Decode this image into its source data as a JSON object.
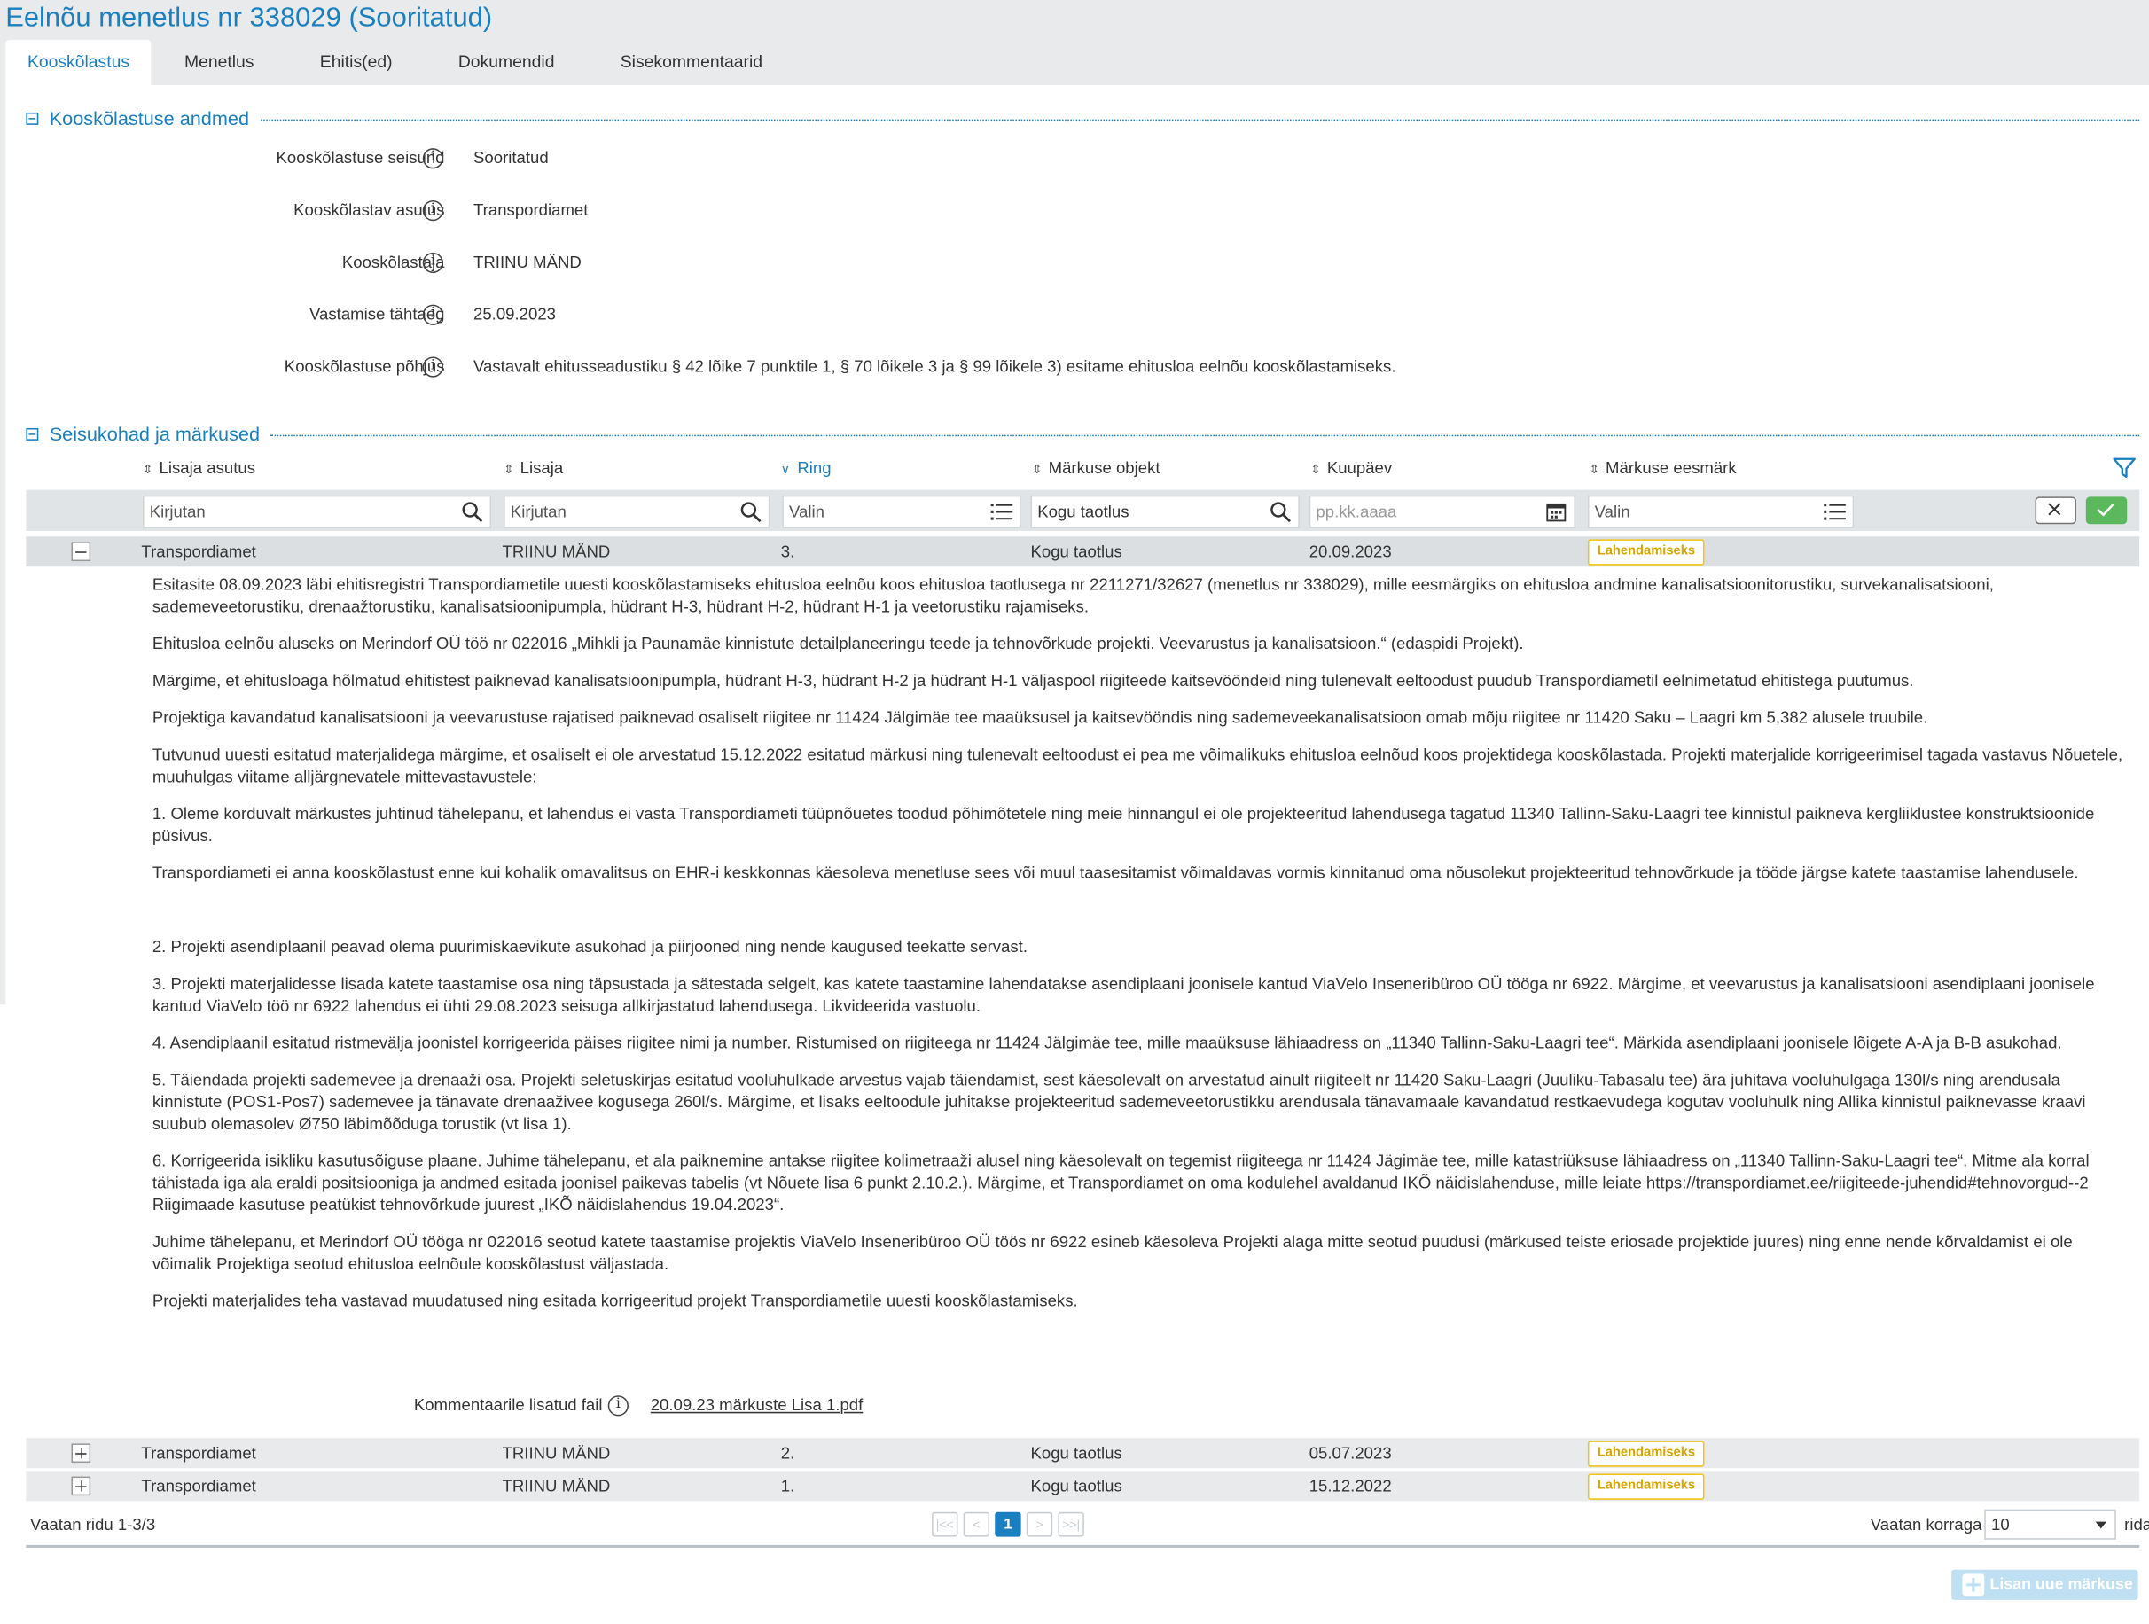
{
  "page": {
    "title": "Eelnõu menetlus nr 338029 (Sooritatud)",
    "tabs": [
      "Kooskõlastus",
      "Menetlus",
      "Ehitis(ed)",
      "Dokumendid",
      "Sisekommentaarid"
    ],
    "active_tab": "Kooskõlastus"
  },
  "details": {
    "title": "Kooskõlastuse andmed",
    "fields": [
      {
        "label": "Kooskõlastuse seisund",
        "value": "Sooritatud"
      },
      {
        "label": "Kooskõlastav asutus",
        "value": "Transpordiamet"
      },
      {
        "label": "Kooskõlastaja",
        "value": "TRIINU MÄND"
      },
      {
        "label": "Vastamise tähtaeg",
        "value": "25.09.2023"
      },
      {
        "label": "Kooskõlastuse põhjus",
        "value": "Vastavalt ehitusseadustiku § 42 lõike 7 punktile 1, § 70 lõikele 3 ja § 99 lõikele 3) esitame ehitusloa eelnõu kooskõlastamiseks."
      }
    ]
  },
  "remarks": {
    "title": "Seisukohad ja märkused",
    "columns": [
      "Lisaja asutus",
      "Lisaja",
      "Ring",
      "Märkuse objekt",
      "Kuupäev",
      "Märkuse eesmärk"
    ],
    "filters": {
      "lisaja_asutus": "Kirjutan",
      "lisaja": "Kirjutan",
      "ring": "Valin",
      "objekt": "Kogu taotlus",
      "kuupaev": "pp.kk.aaaa",
      "eesmark": "Valin"
    },
    "rows": [
      {
        "asutus": "Transpordiamet",
        "lisaja": "TRIINU MÄND",
        "ring": "3.",
        "objekt": "Kogu taotlus",
        "kuupaev": "20.09.2023",
        "eesmark": "Lahendamiseks",
        "expanded": true
      },
      {
        "asutus": "Transpordiamet",
        "lisaja": "TRIINU MÄND",
        "ring": "2.",
        "objekt": "Kogu taotlus",
        "kuupaev": "05.07.2023",
        "eesmark": "Lahendamiseks",
        "expanded": false
      },
      {
        "asutus": "Transpordiamet",
        "lisaja": "TRIINU MÄND",
        "ring": "1.",
        "objekt": "Kogu taotlus",
        "kuupaev": "15.12.2022",
        "eesmark": "Lahendamiseks",
        "expanded": false
      }
    ],
    "comment_paragraphs": [
      "Esitasite 08.09.2023 läbi ehitisregistri Transpordiametile uuesti kooskõlastamiseks ehitusloa eelnõu koos ehitusloa taotlusega nr 2211271/32627 (menetlus nr 338029), mille eesmärgiks on ehitusloa andmine kanalisatsioonitorustiku, survekanalisatsiooni, sademeveetorustiku, drenaažtorustiku, kanalisatsioonipumpla, hüdrant H-3, hüdrant H-2, hüdrant H-1 ja veetorustiku rajamiseks.",
      "Ehitusloa eelnõu aluseks on Merindorf OÜ töö nr 022016 „Mihkli ja Paunamäe kinnistute detailplaneeringu teede ja tehnovõrkude projekti. Veevarustus ja kanalisatsioon.“ (edaspidi Projekt).",
      "Märgime, et ehitusloaga hõlmatud ehitistest paiknevad kanalisatsioonipumpla, hüdrant H-3, hüdrant H-2 ja hüdrant H-1 väljaspool riigiteede kaitsevööndeid ning tulenevalt eeltoodust puudub Transpordiametil eelnimetatud ehitistega puutumus.",
      "Projektiga kavandatud kanalisatsiooni ja veevarustuse rajatised paiknevad osaliselt riigitee nr 11424 Jälgimäe tee maaüksusel ja kaitsevööndis ning sademeveekanalisatsioon omab mõju riigitee nr 11420 Saku – Laagri km 5,382 alusele truubile.",
      "Tutvunud uuesti esitatud materjalidega märgime, et osaliselt ei ole arvestatud 15.12.2022 esitatud märkusi ning tulenevalt eeltoodust ei pea me võimalikuks ehitusloa eelnõud koos projektidega kooskõlastada. Projekti materjalide korrigeerimisel tagada vastavus Nõuetele, muuhulgas viitame alljärgnevatele mittevastavustele:",
      "1. Oleme korduvalt märkustes juhtinud tähelepanu, et lahendus ei vasta Transpordiameti tüüpnõuetes toodud põhimõtetele ning meie hinnangul ei ole projekteeritud lahendusega tagatud 11340 Tallinn-Saku-Laagri tee kinnistul paikneva kergliiklustee konstruktsioonide püsivus.",
      "Transpordiameti ei anna kooskõlastust enne kui kohalik omavalitsus on EHR-i keskkonnas käesoleva menetluse sees või muul taasesitamist võimaldavas vormis kinnitanud oma nõusolekut projekteeritud tehnovõrkude ja tööde järgse katete taastamise lahendusele.",
      "2. Projekti asendiplaanil peavad olema puurimiskaevikute asukohad ja piirjooned ning nende kaugused teekatte servast.",
      "3. Projekti materjalidesse lisada katete taastamise osa ning täpsustada ja sätestada selgelt,  kas katete taastamine lahendatakse asendiplaani joonisele kantud ViaVelo Inseneribüroo OÜ tööga nr 6922. Märgime, et veevarustus ja kanalisatsiooni asendiplaani joonisele kantud ViaVelo töö nr 6922 lahendus ei ühti 29.08.2023 seisuga allkirjastatud lahendusega. Likvideerida vastuolu.",
      "4. Asendiplaanil esitatud ristmevälja joonistel korrigeerida päises riigitee nimi ja number. Ristumised on riigiteega nr 11424 Jälgimäe tee, mille maaüksuse lähiaadress on „11340 Tallinn-Saku-Laagri tee“. Märkida asendiplaani joonisele lõigete A-A ja B-B asukohad.",
      "5. Täiendada projekti sademevee ja drenaaži osa. Projekti seletuskirjas esitatud vooluhulkade arvestus vajab täiendamist, sest käesolevalt on arvestatud ainult riigiteelt nr 11420 Saku-Laagri (Juuliku-Tabasalu tee) ära juhitava vooluhulgaga 130l/s ning arendusala kinnistute (POS1-Pos7) sademevee ja tänavate drenaaživee kogusega 260l/s.  Märgime, et lisaks eeltoodule juhitakse projekteeritud sademeveetorustikku arendusala tänavamaale kavandatud restkaevudega kogutav vooluhulk ning Allika kinnistul paiknevasse kraavi suubub olemasolev Ø750 läbimõõduga torustik (vt lisa 1).",
      "6. Korrigeerida isikliku kasutusõiguse plaane. Juhime tähelepanu, et ala paiknemine antakse riigitee kolimetraaži alusel ning käesolevalt on tegemist riigiteega nr 11424 Jägimäe tee, mille katastriüksuse lähiaadress on „11340 Tallinn-Saku-Laagri tee“. Mitme ala korral tähistada iga ala eraldi positsiooniga ja andmed esitada joonisel paikevas tabelis (vt Nõuete lisa 6 punkt 2.10.2.). Märgime, et Transpordiamet on oma kodulehel avaldanud IKÕ näidislahenduse, mille leiate https://transpordiamet.ee/riigiteede-juhendid#tehnovorgud--2 Riigimaade kasutuse peatükist tehnovõrkude juurest „IKÕ näidislahendus 19.04.2023“.",
      "Juhime tähelepanu, et Merindorf OÜ tööga nr 022016 seotud katete taastamise projektis ViaVelo Inseneribüroo OÜ töös nr 6922 esineb käesoleva Projekti alaga mitte seotud puudusi (märkused teiste eriosade projektide juures) ning enne nende kõrvaldamist ei ole võimalik Projektiga seotud ehitusloa eelnõule kooskõlastust väljastada.",
      "Projekti materjalides teha vastavad muudatused ning esitada korrigeeritud projekt Transpordiametile uuesti kooskõlastamiseks."
    ],
    "attachment": {
      "label": "Kommentaarile lisatud fail",
      "filename": "20.09.23 märkuste Lisa 1.pdf"
    },
    "pager": {
      "summary": "Vaatan ridu 1-3/3",
      "first": "|<<",
      "prev": "<",
      "current_page": "1",
      "next": ">",
      "last": ">>|",
      "per_page_label": "Vaatan korraga",
      "per_page": "10",
      "rows_label": "rida"
    },
    "add_button": "Lisan uue märkuse"
  }
}
